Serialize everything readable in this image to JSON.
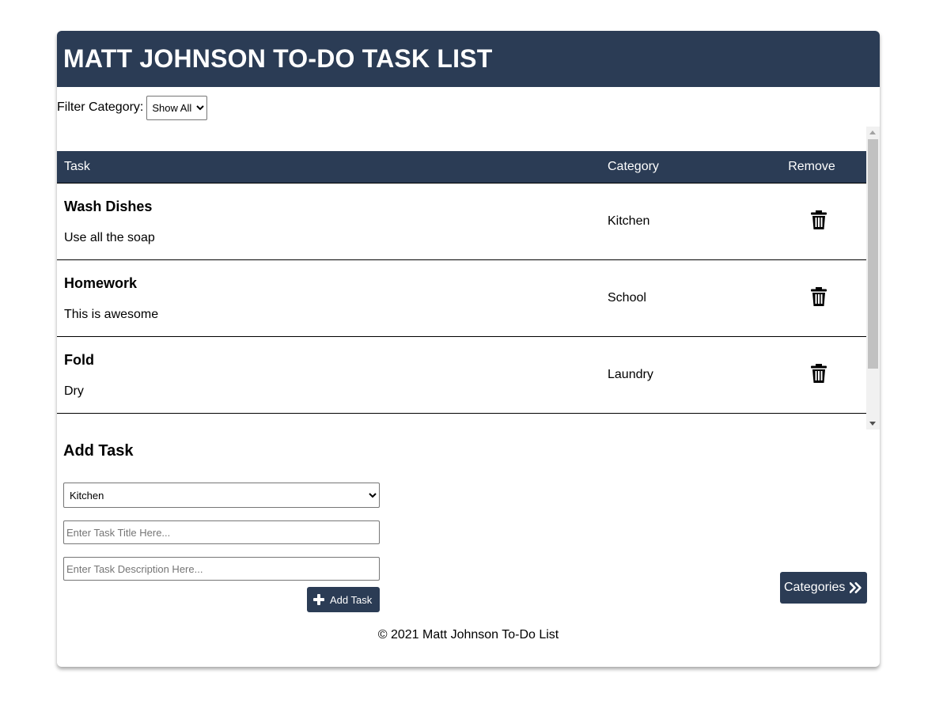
{
  "header": {
    "title": "MATT JOHNSON TO-DO TASK LIST"
  },
  "filter": {
    "label": "Filter Category:",
    "selected": "Show All"
  },
  "table": {
    "headers": {
      "task": "Task",
      "category": "Category",
      "remove": "Remove"
    },
    "rows": [
      {
        "title": "Wash Dishes",
        "description": "Use all the soap",
        "category": "Kitchen"
      },
      {
        "title": "Homework",
        "description": "This is awesome",
        "category": "School"
      },
      {
        "title": "Fold",
        "description": "Dry",
        "category": "Laundry"
      }
    ]
  },
  "add_task": {
    "heading": "Add Task",
    "category_selected": "Kitchen",
    "title_placeholder": "Enter Task Title Here...",
    "description_placeholder": "Enter Task Description Here...",
    "button_label": "Add Task"
  },
  "categories_button": {
    "label": "Categories"
  },
  "footer": {
    "text": "© 2021 Matt Johnson To-Do List"
  },
  "colors": {
    "primary": "#2b3c55"
  },
  "icons": {
    "remove": "trash-icon",
    "add": "plus-icon",
    "categories": "double-chevron-right-icon"
  }
}
